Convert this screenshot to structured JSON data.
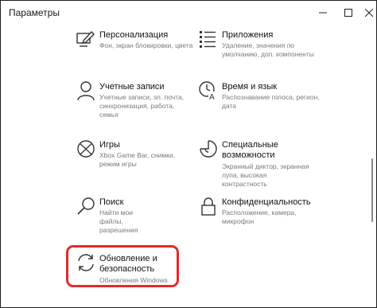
{
  "window": {
    "title": "Параметры",
    "minimize_icon": "minimize-icon",
    "maximize_icon": "maximize-icon",
    "close_icon": "close-icon"
  },
  "items": [
    {
      "title": "Персонализация",
      "desc": "Фон, экран блокировки, цвета",
      "icon": "personalization-pen-icon"
    },
    {
      "title": "Приложения",
      "desc": "Удаление, значения по умолчанию, доп. компоненты",
      "icon": "apps-list-icon"
    },
    {
      "title": "Учетные записи",
      "desc": "Учетные записи, эл. почта, синхронизация, работа, семья",
      "icon": "user-icon"
    },
    {
      "title": "Время и язык",
      "desc": "Распознавание голоса, регион, дата",
      "icon": "time-language-icon"
    },
    {
      "title": "Игры",
      "desc": "Xbox Game Bar, снимки, режим игры",
      "icon": "xbox-icon"
    },
    {
      "title": "Специальные возможности",
      "desc": "Экранный диктор, экранная лупа, высокая контрастность",
      "icon": "accessibility-icon"
    },
    {
      "title": "Поиск",
      "desc": "Найти мои файлы, разрешения",
      "icon": "search-icon"
    },
    {
      "title": "Конфиденциальность",
      "desc": "Расположение, камера, микрофон",
      "icon": "lock-icon"
    },
    {
      "title": "Обновление и безопасность",
      "desc": "Обновления Windows",
      "icon": "update-sync-icon"
    }
  ],
  "highlight_color": "#e32a2a"
}
